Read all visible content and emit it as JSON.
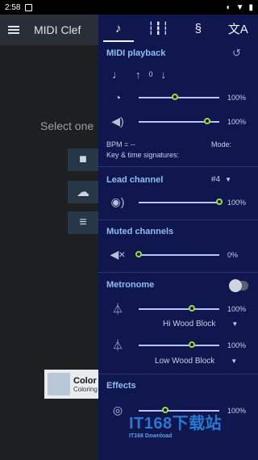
{
  "status_bar": {
    "time": "2:58"
  },
  "background_app": {
    "title": "MIDI Clef",
    "select_text": "Select one",
    "ad_title": "Color",
    "ad_subtitle": "Coloring"
  },
  "drawer": {
    "tabs": [
      {
        "icon": "music-note-icon"
      },
      {
        "icon": "waveform-icon"
      },
      {
        "icon": "clef-icon"
      },
      {
        "icon": "translate-icon"
      }
    ],
    "midi_playback": {
      "title": "MIDI playback",
      "transpose_value": "0",
      "tempo_pct": "100%",
      "tempo_level": 0.45,
      "volume_pct": "100%",
      "volume_level": 0.85,
      "bpm": "BPM = --",
      "mode": "Mode:",
      "key_time": "Key & time signatures:"
    },
    "lead_channel": {
      "title": "Lead channel",
      "channel": "#4",
      "volume_pct": "100%",
      "volume_level": 1.0
    },
    "muted_channels": {
      "title": "Muted channels",
      "volume_pct": "0%",
      "volume_level": 0.0
    },
    "metronome": {
      "title": "Metronome",
      "slider1_pct": "100%",
      "slider1_level": 0.66,
      "sound1": "Hi Wood Block",
      "slider2_pct": "100%",
      "slider2_level": 0.66,
      "sound2": "Low Wood Block"
    },
    "effects": {
      "title": "Effects",
      "slider_pct": "100%",
      "slider_level": 0.33
    }
  },
  "watermark": {
    "big": "IT168下载站",
    "sub": "IT168 Download"
  },
  "colors": {
    "drawer_bg": "#0f174e",
    "accent_title": "#8fbef4",
    "knob": "#9cdc3a"
  }
}
